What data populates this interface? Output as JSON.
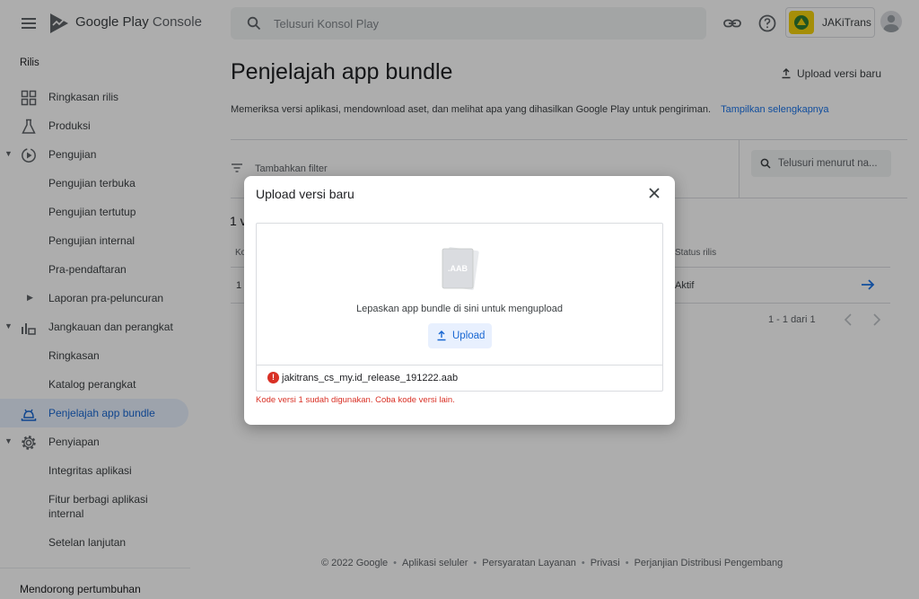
{
  "header": {
    "brand_google": "Google Play",
    "brand_console": "Console",
    "search_placeholder": "Telusuri Konsol Play",
    "account_name": "JAKiTrans"
  },
  "sidebar": {
    "section_title": "Rilis",
    "items": [
      {
        "label": "Ringkasan rilis"
      },
      {
        "label": "Produksi"
      },
      {
        "label": "Pengujian"
      },
      {
        "label": "Pengujian terbuka"
      },
      {
        "label": "Pengujian tertutup"
      },
      {
        "label": "Pengujian internal"
      },
      {
        "label": "Pra-pendaftaran"
      },
      {
        "label": "Laporan pra-peluncuran"
      },
      {
        "label": "Jangkauan dan perangkat"
      },
      {
        "label": "Ringkasan"
      },
      {
        "label": "Katalog perangkat"
      },
      {
        "label": "Penjelajah app bundle"
      },
      {
        "label": "Penyiapan"
      },
      {
        "label": "Integritas aplikasi"
      },
      {
        "label": "Fitur berbagi aplikasi internal"
      },
      {
        "label": "Setelan lanjutan"
      }
    ],
    "bottom_section": "Mendorong pertumbuhan"
  },
  "main": {
    "title": "Penjelajah app bundle",
    "upload_new": "Upload versi baru",
    "subtitle": "Memeriksa versi aplikasi, mendownload aset, dan melihat apa yang dihasilkan Google Play untuk pengiriman.",
    "show_more": "Tampilkan selengkapnya",
    "filter_label": "Tambahkan filter",
    "filter_search_placeholder": "Telusuri menurut na...",
    "count_text": "1 v",
    "columns": {
      "first": "Ko",
      "status": "Status rilis"
    },
    "row": {
      "first": "1",
      "status": "Aktif"
    },
    "pagination": "1 - 1 dari 1"
  },
  "footer": {
    "copyright": "© 2022 Google",
    "links": [
      "Aplikasi seluler",
      "Persyaratan Layanan",
      "Privasi",
      "Perjanjian Distribusi Pengembang"
    ]
  },
  "dialog": {
    "title": "Upload versi baru",
    "file_badge": ".AAB",
    "drop_text": "Lepaskan app bundle di sini untuk mengupload",
    "upload_button": "Upload",
    "file_name": "jakitrans_cs_my.id_release_191222.aab",
    "error_message": "Kode versi 1 sudah digunakan. Coba kode versi lain.",
    "error_glyph": "!"
  },
  "colors": {
    "accent": "#1a73e8",
    "active_bg": "#e8f0fe",
    "error": "#d93025",
    "account_logo": "#f4d10d"
  }
}
